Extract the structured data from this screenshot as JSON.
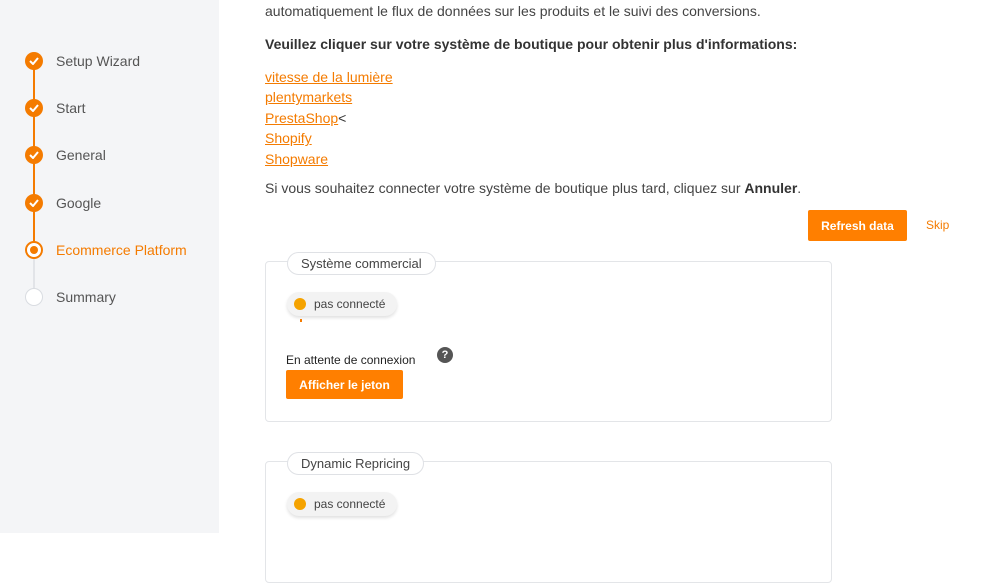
{
  "sidebar": {
    "steps": [
      {
        "label": "Setup Wizard",
        "state": "done"
      },
      {
        "label": "Start",
        "state": "done"
      },
      {
        "label": "General",
        "state": "done"
      },
      {
        "label": "Google",
        "state": "done"
      },
      {
        "label": "Ecommerce Platform",
        "state": "current"
      },
      {
        "label": "Summary",
        "state": "todo"
      }
    ]
  },
  "content": {
    "intro_text": "automatiquement le flux de données sur les produits et le suivi des conversions.",
    "prompt": "Veuillez cliquer sur votre système de boutique pour obtenir plus d'informations:",
    "shop_links": [
      "vitesse de la lumière",
      "plentymarkets",
      "PrestaShop",
      "Shopify",
      "Shopware"
    ],
    "prestashop_suffix": "<",
    "later_text": "Si vous souhaitez connecter votre système de boutique plus tard, cliquez sur ",
    "later_bold": "Annuler",
    "later_end": "."
  },
  "actions": {
    "refresh_label": "Refresh data",
    "skip_label": "Skip"
  },
  "cards": [
    {
      "title": "Système commercial",
      "status": "pas connecté",
      "waiting_text": "En attente de connexion",
      "button_label": "Afficher le jeton"
    },
    {
      "title": "Dynamic Repricing",
      "status": "pas connecté"
    }
  ],
  "icons": {
    "done": "check-icon",
    "help": "question-circle-icon"
  },
  "colors": {
    "accent": "#f47b00",
    "button": "#ff7f00",
    "status_pending": "#f5a300",
    "sidebar_bg": "#f4f5f7"
  }
}
